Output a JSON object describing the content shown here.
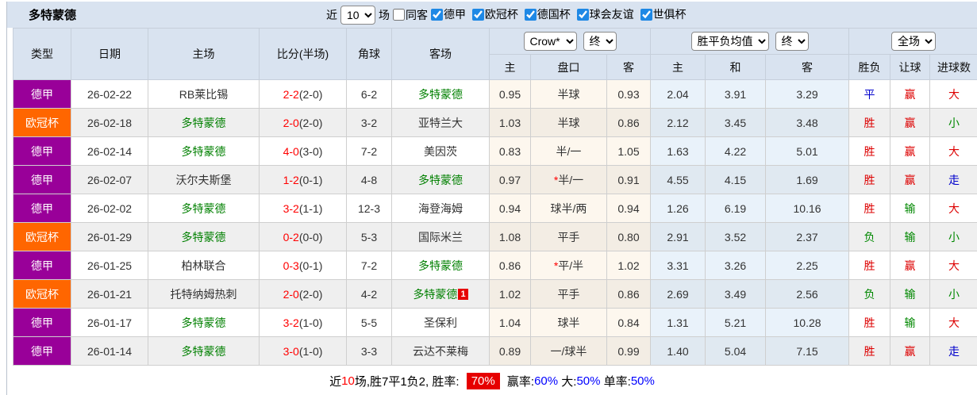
{
  "top_bar": {
    "title": "多特蒙德",
    "recent_label": "近",
    "recent_select": "10",
    "matches_label": "场",
    "same_away_checkbox": {
      "label": "同客",
      "checked": false
    },
    "league_filters": [
      {
        "label": "德甲",
        "checked": true
      },
      {
        "label": "欧冠杯",
        "checked": true
      },
      {
        "label": "德国杯",
        "checked": true
      },
      {
        "label": "球会友谊",
        "checked": true
      },
      {
        "label": "世俱杯",
        "checked": true
      }
    ]
  },
  "table": {
    "left_columns": [
      "类型",
      "日期",
      "主场",
      "比分(半场)",
      "角球",
      "客场"
    ],
    "asia_company_select": "Crow*",
    "asia_time_select": "终",
    "europe_type_select": "胜平负均值",
    "europe_time_select": "终",
    "scope_select": "全场",
    "sub_columns": [
      "主",
      "盘口",
      "客",
      "主",
      "和",
      "客",
      "胜负",
      "让球",
      "进球数"
    ]
  },
  "league_colors": {
    "德甲": "#990099",
    "欧冠杯": "#FF6600"
  },
  "status_colors": {
    "red": "#DD0000",
    "green": "#008800",
    "blue": "#0000CC"
  },
  "rows": [
    {
      "league": "德甲",
      "date": "26-02-22",
      "home": "RB莱比锡",
      "home_highlight": false,
      "score_ft": "2-2",
      "score_ht": "(2-0)",
      "corner": "6-2",
      "away": "多特蒙德",
      "away_highlight": true,
      "away_badge": "",
      "asia_home": "0.95",
      "asia_star": false,
      "asia_handicap": "半球",
      "asia_away": "0.93",
      "euro_home": "2.04",
      "euro_draw": "3.91",
      "euro_away": "3.29",
      "result": {
        "text": "平",
        "color": "blue"
      },
      "handicap_result": {
        "text": "赢",
        "color": "red"
      },
      "goals_result": {
        "text": "大",
        "color": "red"
      }
    },
    {
      "league": "欧冠杯",
      "date": "26-02-18",
      "home": "多特蒙德",
      "home_highlight": true,
      "score_ft": "2-0",
      "score_ht": "(2-0)",
      "corner": "3-2",
      "away": "亚特兰大",
      "away_highlight": false,
      "away_badge": "",
      "asia_home": "1.03",
      "asia_star": false,
      "asia_handicap": "半球",
      "asia_away": "0.86",
      "euro_home": "2.12",
      "euro_draw": "3.45",
      "euro_away": "3.48",
      "result": {
        "text": "胜",
        "color": "red"
      },
      "handicap_result": {
        "text": "赢",
        "color": "red"
      },
      "goals_result": {
        "text": "小",
        "color": "green"
      }
    },
    {
      "league": "德甲",
      "date": "26-02-14",
      "home": "多特蒙德",
      "home_highlight": true,
      "score_ft": "4-0",
      "score_ht": "(3-0)",
      "corner": "7-2",
      "away": "美因茨",
      "away_highlight": false,
      "away_badge": "",
      "asia_home": "0.83",
      "asia_star": false,
      "asia_handicap": "半/一",
      "asia_away": "1.05",
      "euro_home": "1.63",
      "euro_draw": "4.22",
      "euro_away": "5.01",
      "result": {
        "text": "胜",
        "color": "red"
      },
      "handicap_result": {
        "text": "赢",
        "color": "red"
      },
      "goals_result": {
        "text": "大",
        "color": "red"
      }
    },
    {
      "league": "德甲",
      "date": "26-02-07",
      "home": "沃尔夫斯堡",
      "home_highlight": false,
      "score_ft": "1-2",
      "score_ht": "(0-1)",
      "corner": "4-8",
      "away": "多特蒙德",
      "away_highlight": true,
      "away_badge": "",
      "asia_home": "0.97",
      "asia_star": true,
      "asia_handicap": "半/一",
      "asia_away": "0.91",
      "euro_home": "4.55",
      "euro_draw": "4.15",
      "euro_away": "1.69",
      "result": {
        "text": "胜",
        "color": "red"
      },
      "handicap_result": {
        "text": "赢",
        "color": "red"
      },
      "goals_result": {
        "text": "走",
        "color": "blue"
      }
    },
    {
      "league": "德甲",
      "date": "26-02-02",
      "home": "多特蒙德",
      "home_highlight": true,
      "score_ft": "3-2",
      "score_ht": "(1-1)",
      "corner": "12-3",
      "away": "海登海姆",
      "away_highlight": false,
      "away_badge": "",
      "asia_home": "0.94",
      "asia_star": false,
      "asia_handicap": "球半/两",
      "asia_away": "0.94",
      "euro_home": "1.26",
      "euro_draw": "6.19",
      "euro_away": "10.16",
      "result": {
        "text": "胜",
        "color": "red"
      },
      "handicap_result": {
        "text": "输",
        "color": "green"
      },
      "goals_result": {
        "text": "大",
        "color": "red"
      }
    },
    {
      "league": "欧冠杯",
      "date": "26-01-29",
      "home": "多特蒙德",
      "home_highlight": true,
      "score_ft": "0-2",
      "score_ht": "(0-0)",
      "corner": "5-3",
      "away": "国际米兰",
      "away_highlight": false,
      "away_badge": "",
      "asia_home": "1.08",
      "asia_star": false,
      "asia_handicap": "平手",
      "asia_away": "0.80",
      "euro_home": "2.91",
      "euro_draw": "3.52",
      "euro_away": "2.37",
      "result": {
        "text": "负",
        "color": "green"
      },
      "handicap_result": {
        "text": "输",
        "color": "green"
      },
      "goals_result": {
        "text": "小",
        "color": "green"
      }
    },
    {
      "league": "德甲",
      "date": "26-01-25",
      "home": "柏林联合",
      "home_highlight": false,
      "score_ft": "0-3",
      "score_ht": "(0-1)",
      "corner": "7-2",
      "away": "多特蒙德",
      "away_highlight": true,
      "away_badge": "",
      "asia_home": "0.86",
      "asia_star": true,
      "asia_handicap": "平/半",
      "asia_away": "1.02",
      "euro_home": "3.31",
      "euro_draw": "3.26",
      "euro_away": "2.25",
      "result": {
        "text": "胜",
        "color": "red"
      },
      "handicap_result": {
        "text": "赢",
        "color": "red"
      },
      "goals_result": {
        "text": "大",
        "color": "red"
      }
    },
    {
      "league": "欧冠杯",
      "date": "26-01-21",
      "home": "托特纳姆热刺",
      "home_highlight": false,
      "score_ft": "2-0",
      "score_ht": "(2-0)",
      "corner": "4-2",
      "away": "多特蒙德",
      "away_highlight": true,
      "away_badge": "1",
      "asia_home": "1.02",
      "asia_star": false,
      "asia_handicap": "平手",
      "asia_away": "0.86",
      "euro_home": "2.69",
      "euro_draw": "3.49",
      "euro_away": "2.56",
      "result": {
        "text": "负",
        "color": "green"
      },
      "handicap_result": {
        "text": "输",
        "color": "green"
      },
      "goals_result": {
        "text": "小",
        "color": "green"
      }
    },
    {
      "league": "德甲",
      "date": "26-01-17",
      "home": "多特蒙德",
      "home_highlight": true,
      "score_ft": "3-2",
      "score_ht": "(1-0)",
      "corner": "5-5",
      "away": "圣保利",
      "away_highlight": false,
      "away_badge": "",
      "asia_home": "1.04",
      "asia_star": false,
      "asia_handicap": "球半",
      "asia_away": "0.84",
      "euro_home": "1.31",
      "euro_draw": "5.21",
      "euro_away": "10.28",
      "result": {
        "text": "胜",
        "color": "red"
      },
      "handicap_result": {
        "text": "输",
        "color": "green"
      },
      "goals_result": {
        "text": "大",
        "color": "red"
      }
    },
    {
      "league": "德甲",
      "date": "26-01-14",
      "home": "多特蒙德",
      "home_highlight": true,
      "score_ft": "3-0",
      "score_ht": "(1-0)",
      "corner": "3-3",
      "away": "云达不莱梅",
      "away_highlight": false,
      "away_badge": "",
      "asia_home": "0.89",
      "asia_star": false,
      "asia_handicap": "一/球半",
      "asia_away": "0.99",
      "euro_home": "1.40",
      "euro_draw": "5.04",
      "euro_away": "7.15",
      "result": {
        "text": "胜",
        "color": "red"
      },
      "handicap_result": {
        "text": "赢",
        "color": "red"
      },
      "goals_result": {
        "text": "走",
        "color": "blue"
      }
    }
  ],
  "footer": {
    "segments": [
      {
        "text": "近",
        "style": "plain"
      },
      {
        "text": "10",
        "style": "red"
      },
      {
        "text": "场,胜7平1负2, 胜率: ",
        "style": "plain"
      },
      {
        "text": "70%",
        "style": "badge"
      },
      {
        "text": " 赢率:",
        "style": "plain"
      },
      {
        "text": "60%",
        "style": "blue"
      },
      {
        "text": " 大:",
        "style": "plain"
      },
      {
        "text": "50%",
        "style": "blue"
      },
      {
        "text": " 单率:",
        "style": "plain"
      },
      {
        "text": "50%",
        "style": "blue"
      }
    ]
  }
}
